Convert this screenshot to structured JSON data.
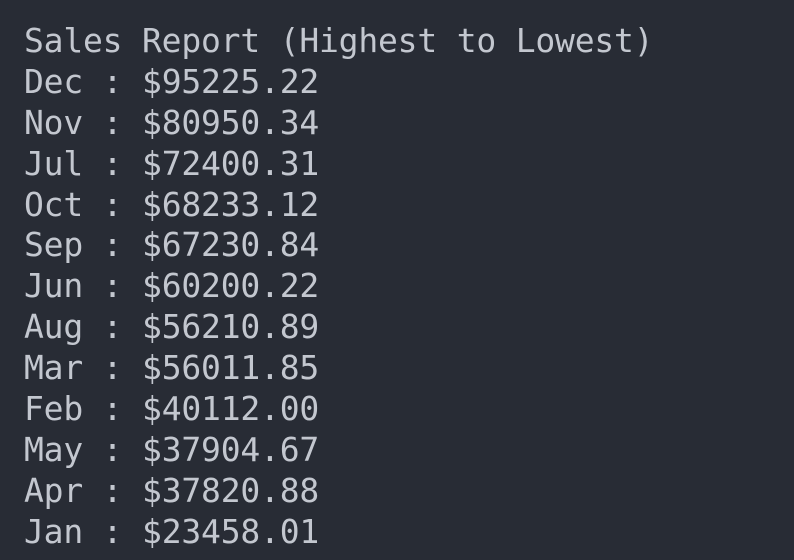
{
  "terminal": {
    "title": "Sales Report (Highest to Lowest)",
    "separator": " : ",
    "rows": [
      {
        "month": "Dec",
        "amount": "$95225.22"
      },
      {
        "month": "Nov",
        "amount": "$80950.34"
      },
      {
        "month": "Jul",
        "amount": "$72400.31"
      },
      {
        "month": "Oct",
        "amount": "$68233.12"
      },
      {
        "month": "Sep",
        "amount": "$67230.84"
      },
      {
        "month": "Jun",
        "amount": "$60200.22"
      },
      {
        "month": "Aug",
        "amount": "$56210.89"
      },
      {
        "month": "Mar",
        "amount": "$56011.85"
      },
      {
        "month": "Feb",
        "amount": "$40112.00"
      },
      {
        "month": "May",
        "amount": "$37904.67"
      },
      {
        "month": "Apr",
        "amount": "$37820.88"
      },
      {
        "month": "Jan",
        "amount": "$23458.01"
      }
    ]
  },
  "colors": {
    "background": "#282c35",
    "text": "#c3c7cf"
  }
}
